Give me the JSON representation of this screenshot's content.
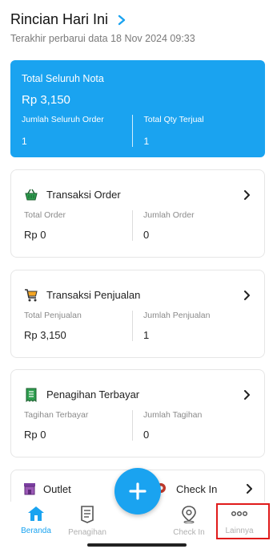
{
  "header": {
    "title": "Rincian Hari Ini",
    "subtitle": "Terakhir perbarui data 18 Nov 2024 09:33"
  },
  "summary": {
    "label": "Total Seluruh Nota",
    "total": "Rp 3,150",
    "left_label": "Jumlah Seluruh Order",
    "left_value": "1",
    "right_label": "Total Qty Terjual",
    "right_value": "1",
    "color": "#1aa3f0"
  },
  "cards": [
    {
      "title": "Transaksi Order",
      "icon": "basket-icon",
      "left_label": "Total Order",
      "left_value": "Rp 0",
      "right_label": "Jumlah Order",
      "right_value": "0"
    },
    {
      "title": "Transaksi Penjualan",
      "icon": "cart-icon",
      "left_label": "Total Penjualan",
      "left_value": "Rp 3,150",
      "right_label": "Jumlah Penjualan",
      "right_value": "1"
    },
    {
      "title": "Penagihan Terbayar",
      "icon": "receipt-icon",
      "left_label": "Tagihan Terbayar",
      "left_value": "Rp 0",
      "right_label": "Jumlah Tagihan",
      "right_value": "0"
    }
  ],
  "partial_card": {
    "left_title": "Outlet",
    "right_title": "Check In"
  },
  "bottom_nav": [
    {
      "label": "Beranda",
      "icon": "home-icon",
      "active": true
    },
    {
      "label": "Penagihan",
      "icon": "document-icon",
      "active": false
    },
    {
      "label": "Check In",
      "icon": "location-pin-icon",
      "active": false
    },
    {
      "label": "Lainnya",
      "icon": "more-dots-icon",
      "active": false
    }
  ],
  "accent_color": "#1aa3f0",
  "highlight_color": "#e01b1b"
}
